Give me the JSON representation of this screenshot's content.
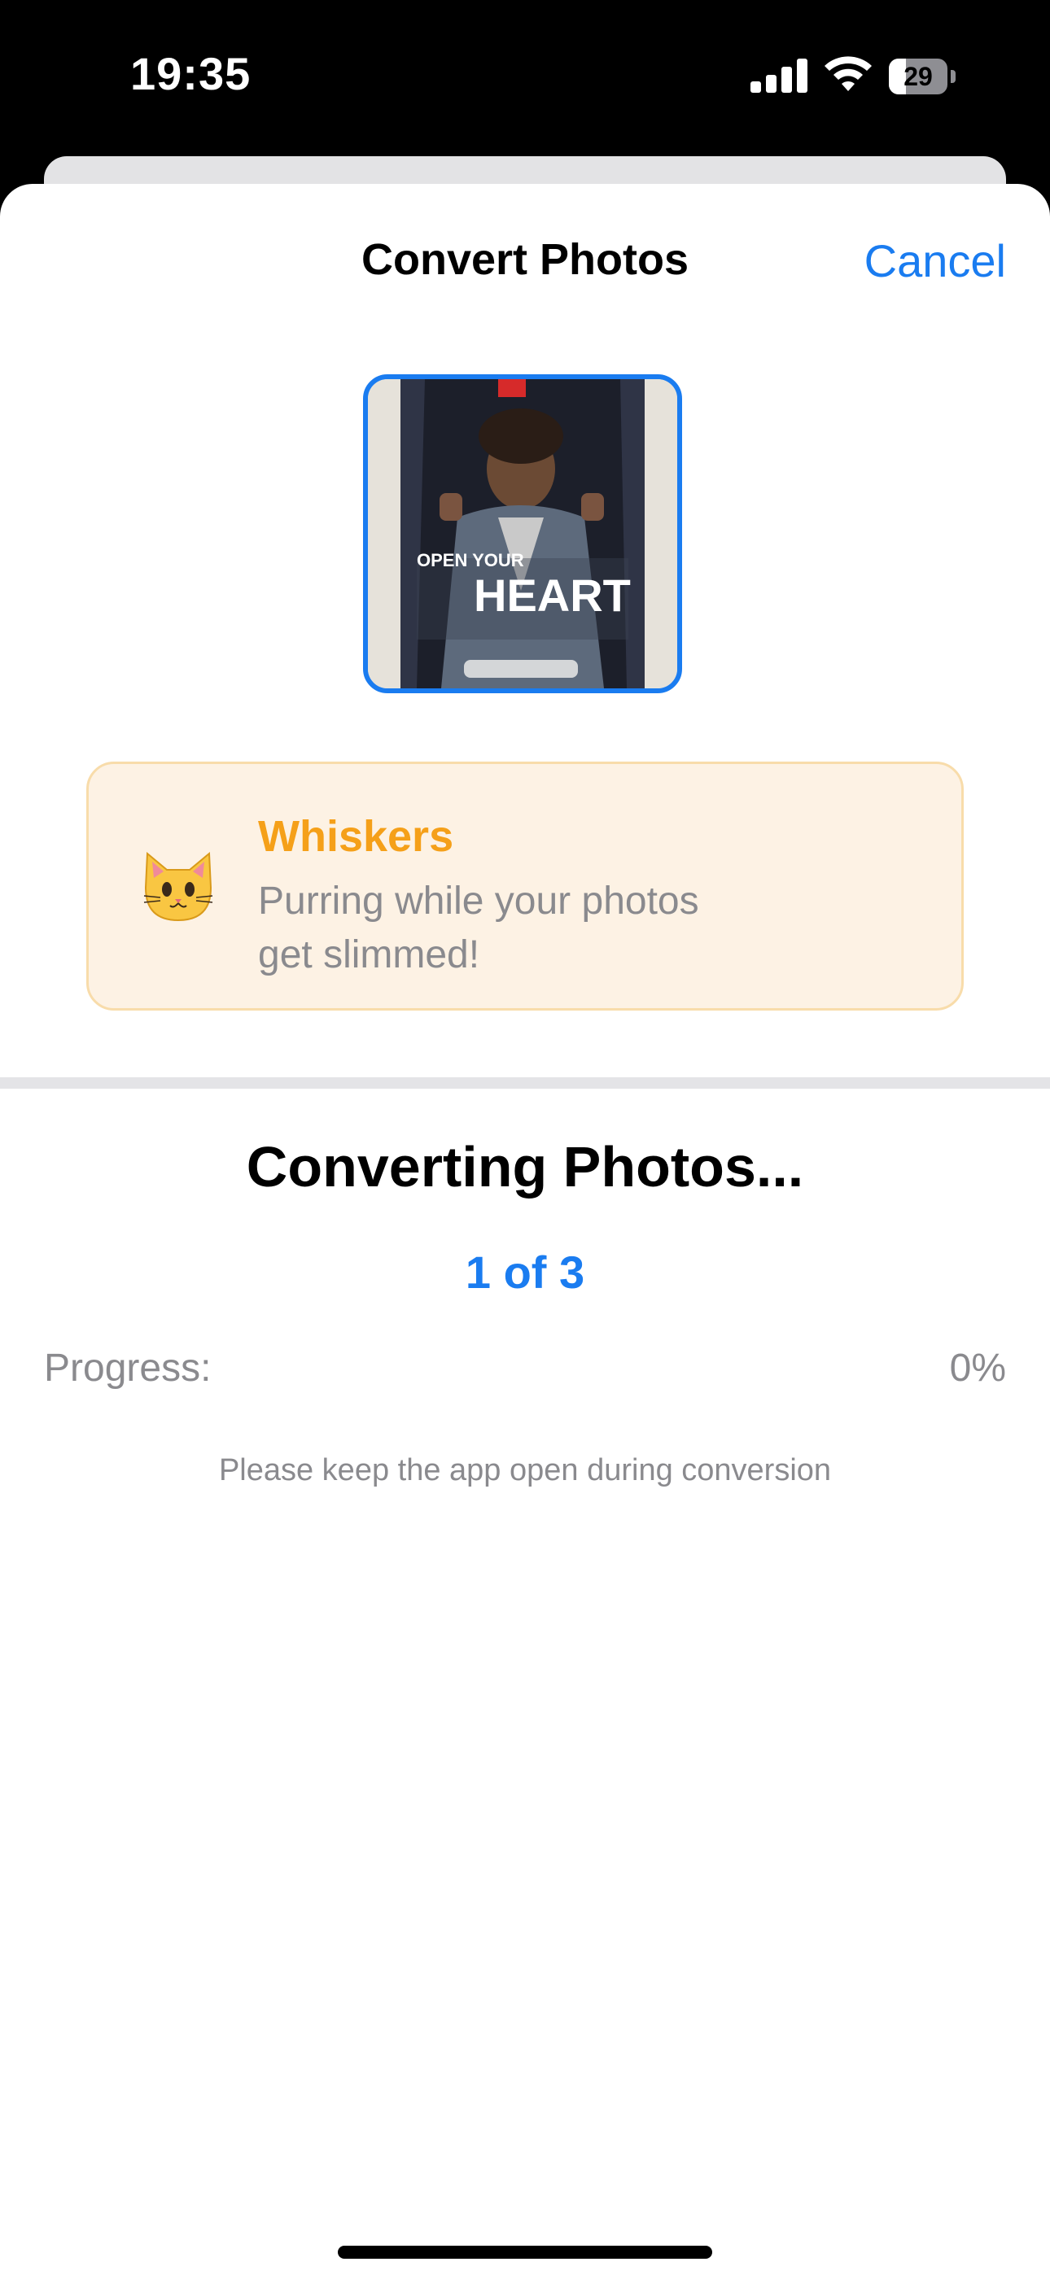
{
  "status_bar": {
    "time": "19:35",
    "battery_level": "29",
    "battery_fraction": 0.29,
    "signal_icon": "cellular-signal-icon",
    "wifi_icon": "wifi-icon"
  },
  "sheet": {
    "title": "Convert Photos",
    "cancel_label": "Cancel"
  },
  "thumbnail": {
    "caption_top": "OPEN YOUR",
    "caption_big": "HEART",
    "selected_color": "#1a7cf0"
  },
  "mascot": {
    "icon": "cat-face-icon",
    "name": "Whiskers",
    "message": "Purring while your photos get slimmed!",
    "accent": "#f5a019",
    "card_bg": "#fdf2e4"
  },
  "conversion": {
    "title": "Converting Photos...",
    "counter": "1 of 3",
    "progress_label": "Progress:",
    "progress_value": "0%",
    "progress_fraction": 0,
    "hint": "Please keep the app open during conversion"
  },
  "colors": {
    "accent": "#1a7cf0",
    "secondary_text": "#8a8a8e"
  }
}
